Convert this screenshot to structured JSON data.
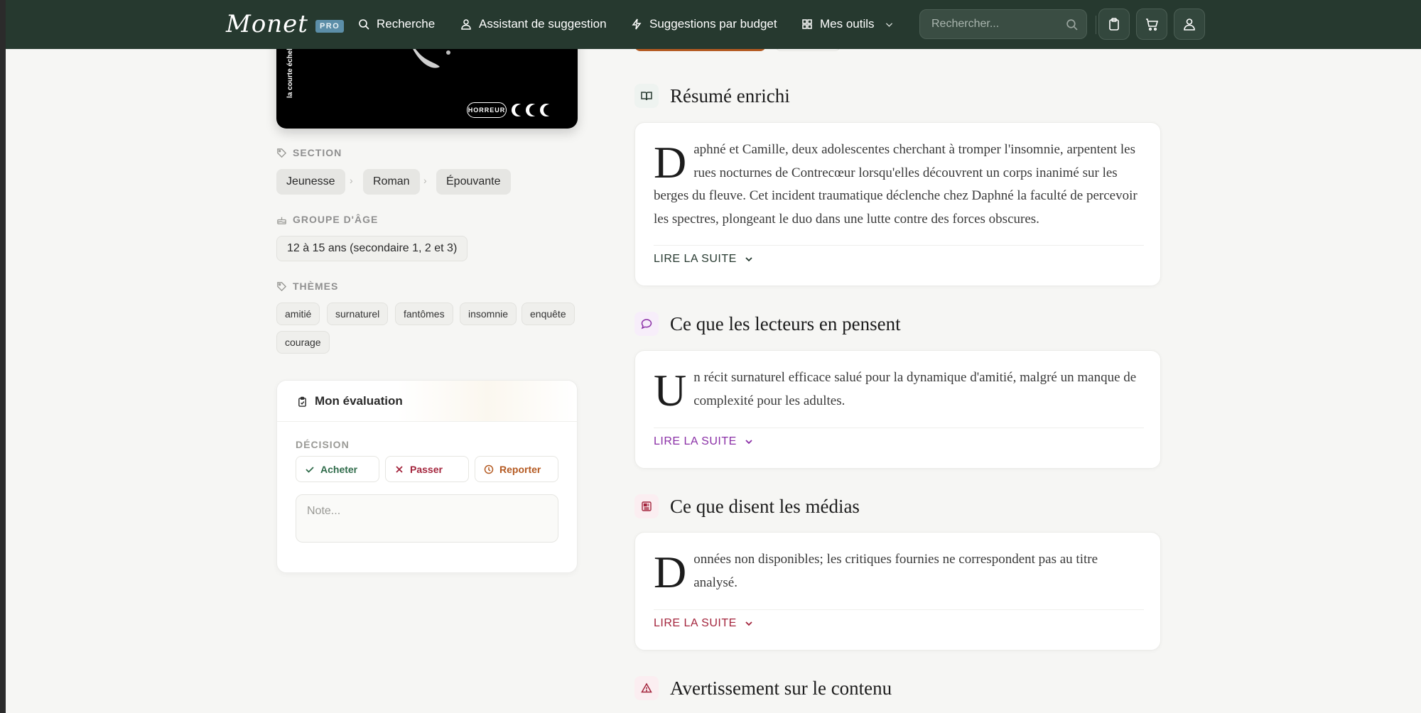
{
  "nav": {
    "logo": "Monet",
    "logo_badge": "PRO",
    "items": [
      {
        "label": "Recherche",
        "icon": "search-icon"
      },
      {
        "label": "Assistant de suggestion",
        "icon": "user-assistant-icon"
      },
      {
        "label": "Suggestions par budget",
        "icon": "lightning-icon"
      },
      {
        "label": "Mes outils",
        "icon": "grid-icon"
      }
    ],
    "search_placeholder": "Rechercher..."
  },
  "cover": {
    "spine_text": "la courte échelle",
    "badge": "HORREUR"
  },
  "section": {
    "label": "SECTION",
    "breadcrumb": [
      "Jeunesse",
      "Roman",
      "Épouvante"
    ]
  },
  "age": {
    "label": "GROUPE D'ÂGE",
    "value": "12 à 15 ans (secondaire 1, 2 et 3)"
  },
  "themes": {
    "label": "THÈMES",
    "items": [
      "amitié",
      "surnaturel",
      "fantômes",
      "insomnie",
      "enquête",
      "courage"
    ]
  },
  "evaluation": {
    "title": "Mon évaluation",
    "decision_label": "DÉCISION",
    "buy": "Acheter",
    "pass": "Passer",
    "postpone": "Reporter",
    "note_placeholder": "Note..."
  },
  "summary": {
    "title": "Résumé enrichi",
    "dropcap": "D",
    "text": "aphné et Camille, deux adolescentes cherchant à tromper l'insomnie, arpentent les rues nocturnes de Contrecœur lorsqu'elles découvrent un corps inanimé sur les berges du fleuve. Cet incident traumatique déclenche chez Daphné la faculté de percevoir les spectres, plongeant le duo dans une lutte contre des forces obscures.",
    "read_more": "LIRE LA SUITE"
  },
  "readers": {
    "title": "Ce que les lecteurs en pensent",
    "dropcap": "U",
    "text": "n récit surnaturel efficace salué pour la dynamique d'amitié, malgré un manque de complexité pour les adultes.",
    "read_more": "LIRE LA SUITE"
  },
  "media": {
    "title": "Ce que disent les médias",
    "dropcap": "D",
    "text": "onnées non disponibles; les critiques fournies ne correspondent pas au titre analysé.",
    "read_more": "LIRE LA SUITE"
  },
  "warning": {
    "title": "Avertissement sur le contenu"
  },
  "colors": {
    "nav_bg": "#26392f",
    "accent_green": "#2f6b4a",
    "accent_purple": "#8a2fa6",
    "accent_red": "#a3243c",
    "accent_orange": "#b45a22"
  }
}
